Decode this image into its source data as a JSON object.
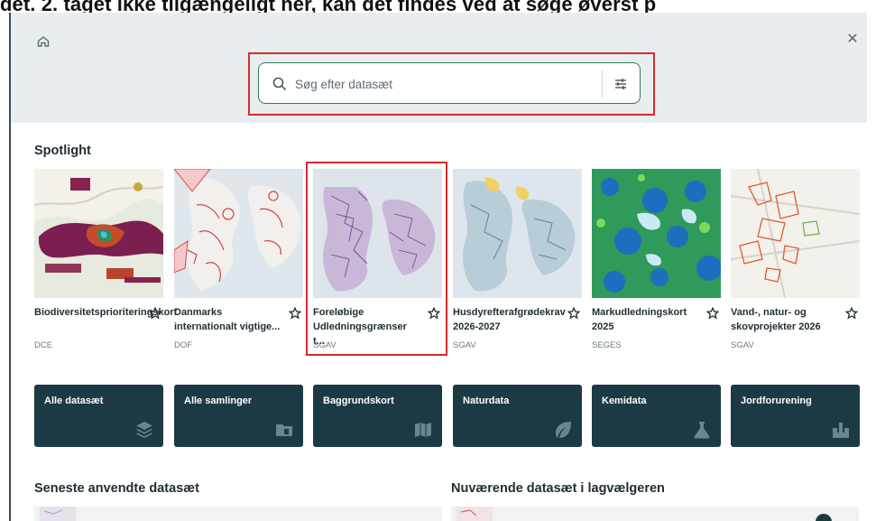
{
  "caption": "det. 2. taget ikke tilgængeligt her, kan det findes ved at søge øverst p",
  "search": {
    "placeholder": "Søg efter datasæt"
  },
  "spotlight": {
    "title": "Spotlight",
    "cards": [
      {
        "title": "Biodiversitetsprioriteringskort",
        "source": "DCE"
      },
      {
        "title": "Danmarks internationalt vigtige...",
        "source": "DOF"
      },
      {
        "title": "Foreløbige Udledningsgrænser t...",
        "source": "SGAV"
      },
      {
        "title": "Husdyrefterafgrødekrav 2026-2027",
        "source": "SGAV"
      },
      {
        "title": "Markudledningskort 2025",
        "source": "SEGES"
      },
      {
        "title": "Vand-, natur- og skovprojekter 2026",
        "source": "SGAV"
      }
    ]
  },
  "categories": [
    {
      "label": "Alle datasæt",
      "icon": "layers-icon"
    },
    {
      "label": "Alle samlinger",
      "icon": "folder-icon"
    },
    {
      "label": "Baggrundskort",
      "icon": "map-icon"
    },
    {
      "label": "Naturdata",
      "icon": "leaf-icon"
    },
    {
      "label": "Kemidata",
      "icon": "flask-icon"
    },
    {
      "label": "Jordforurening",
      "icon": "soil-icon"
    }
  ],
  "recent": {
    "title": "Seneste anvendte datasæt"
  },
  "current": {
    "title": "Nuværende datasæt i lagvælgeren"
  },
  "colors": {
    "dark_tile": "#1c3a44",
    "accent_green": "#2e7a5a",
    "highlight_red": "#d52b2b",
    "topbar": "#e8edf0"
  }
}
